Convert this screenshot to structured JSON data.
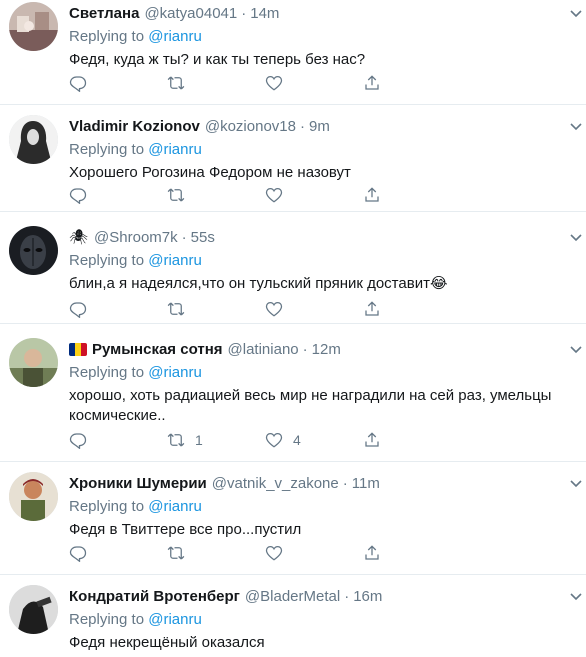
{
  "colors": {
    "text": "#14171a",
    "muted": "#657786",
    "link": "#1b95e0",
    "divider": "#e6ecf0"
  },
  "replying_prefix": "Replying to",
  "replying_target": "@rianru",
  "tweets": [
    {
      "name": "Светлана",
      "handle": "@katya04041",
      "separator": "·",
      "time": "14m",
      "text": "Федя, куда ж ты? и как ты теперь без нас?",
      "retweets": "",
      "likes": ""
    },
    {
      "name": "Vladimir Kozionov",
      "handle": "@kozionov18",
      "separator": "·",
      "time": "9m",
      "text": "Хорошего Рогозина Федором не назовут",
      "retweets": "",
      "likes": ""
    },
    {
      "name": "",
      "handle": "@Shroom7k",
      "separator": "·",
      "time": "55s",
      "text": "блин,а я надеялся,что он тульский пряник доставит😂",
      "retweets": "",
      "likes": "",
      "name_icon": "spider-icon"
    },
    {
      "name": "Румынская сотня",
      "handle": "@latiniano",
      "separator": "·",
      "time": "12m",
      "text": "хорошо, хоть радиацией весь мир не наградили на сей раз, умельцы космические..",
      "retweets": "1",
      "likes": "4",
      "name_icon": "romania-flag-icon"
    },
    {
      "name": "Хроники Шумерии",
      "handle": "@vatnik_v_zakone",
      "separator": "·",
      "time": "11m",
      "text": "Федя в Твиттере все про...пустил",
      "retweets": "",
      "likes": ""
    },
    {
      "name": "Кондратий Вротенберг",
      "handle": "@BladerMetal",
      "separator": "·",
      "time": "16m",
      "text": "Федя некрещёный оказался",
      "retweets": "",
      "likes": ""
    }
  ]
}
